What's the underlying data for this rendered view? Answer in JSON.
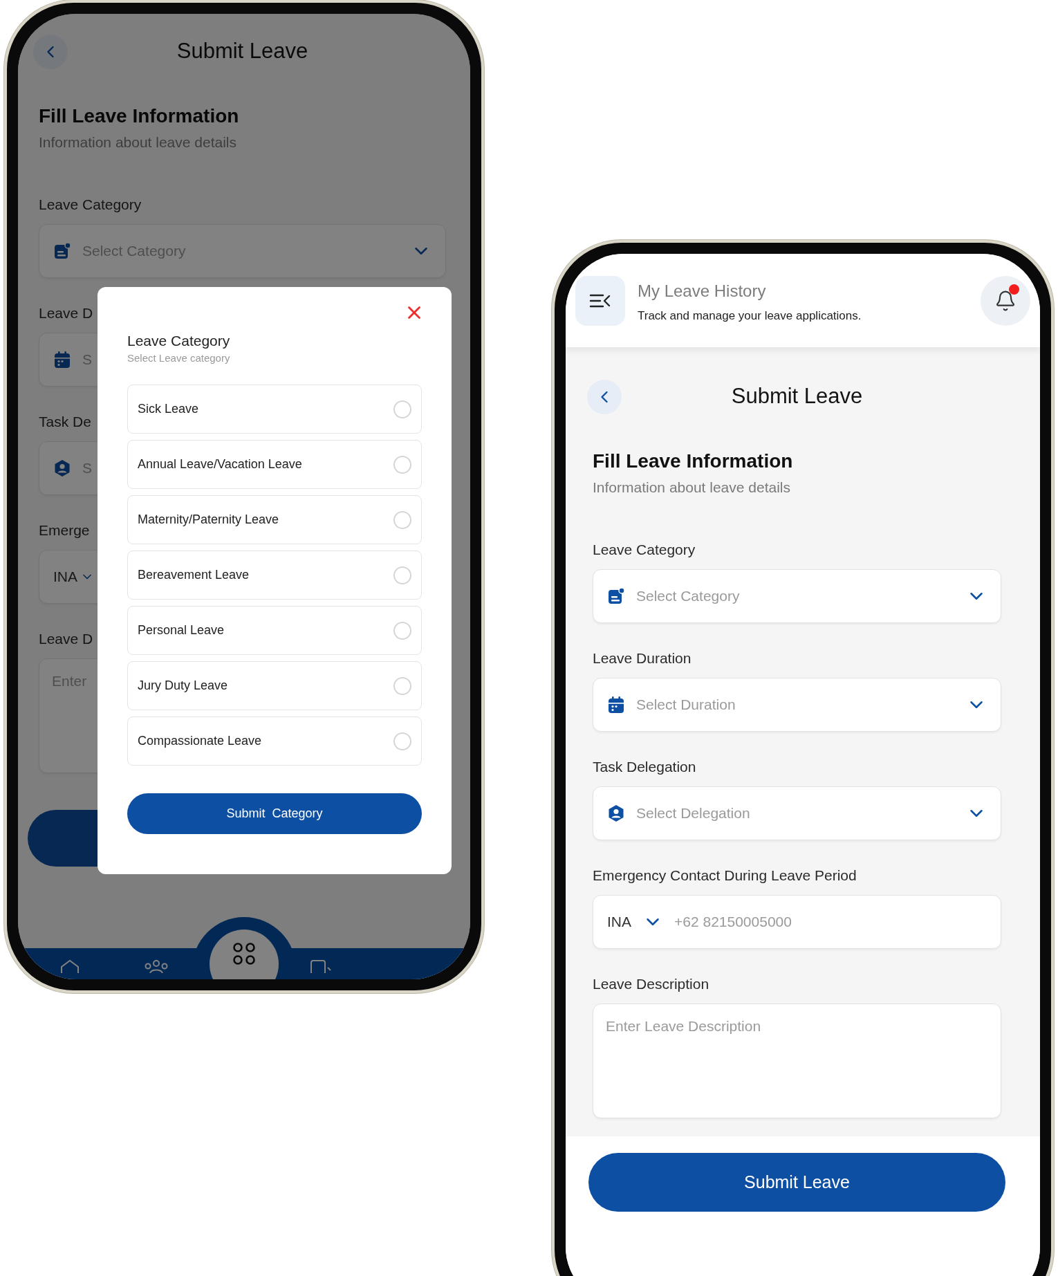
{
  "left_phone": {
    "screen": {
      "title": "Submit Leave",
      "section_title": "Fill Leave Information",
      "section_subtitle": "Information about leave details",
      "fields": [
        {
          "kind": "select",
          "label": "Leave Category",
          "placeholder": "Select Category"
        },
        {
          "kind": "select",
          "label": "Leave D",
          "placeholder": "S"
        },
        {
          "kind": "select",
          "label": "Task De",
          "placeholder": "S"
        },
        {
          "kind": "phone",
          "label": "Emerge",
          "country": "INA"
        },
        {
          "kind": "textarea",
          "label": "Leave D",
          "placeholder": "Enter"
        }
      ]
    },
    "modal": {
      "title": "Leave Category",
      "subtitle": "Select Leave category",
      "submit": "Submit  Category",
      "options": [
        {
          "label": "Sick Leave",
          "selected": false
        },
        {
          "label": "Annual Leave/Vacation Leave",
          "selected": false
        },
        {
          "label": "Maternity/Paternity Leave",
          "selected": false
        },
        {
          "label": "Bereavement Leave",
          "selected": false
        },
        {
          "label": "Personal Leave",
          "selected": false
        },
        {
          "label": "Jury Duty Leave",
          "selected": false
        },
        {
          "label": "Compassionate Leave",
          "selected": false
        }
      ]
    }
  },
  "right_phone": {
    "header": {
      "title": "My Leave History",
      "subtitle": "Track and manage your leave applications.",
      "unread": true
    },
    "screen": {
      "title": "Submit Leave",
      "section_title": "Fill Leave Information",
      "section_subtitle": "Information about leave details",
      "fields": [
        {
          "kind": "select",
          "label": "Leave Category",
          "placeholder": "Select Category"
        },
        {
          "kind": "select",
          "label": "Leave Duration",
          "placeholder": "Select Duration"
        },
        {
          "kind": "select",
          "label": "Task Delegation",
          "placeholder": "Select Delegation"
        },
        {
          "kind": "phone",
          "label": "Emergency Contact During Leave Period",
          "country": "INA",
          "placeholder": "+62 82150005000"
        },
        {
          "kind": "textarea",
          "label": "Leave Description",
          "placeholder": "Enter Leave Description"
        }
      ]
    },
    "submit": "Submit Leave"
  }
}
